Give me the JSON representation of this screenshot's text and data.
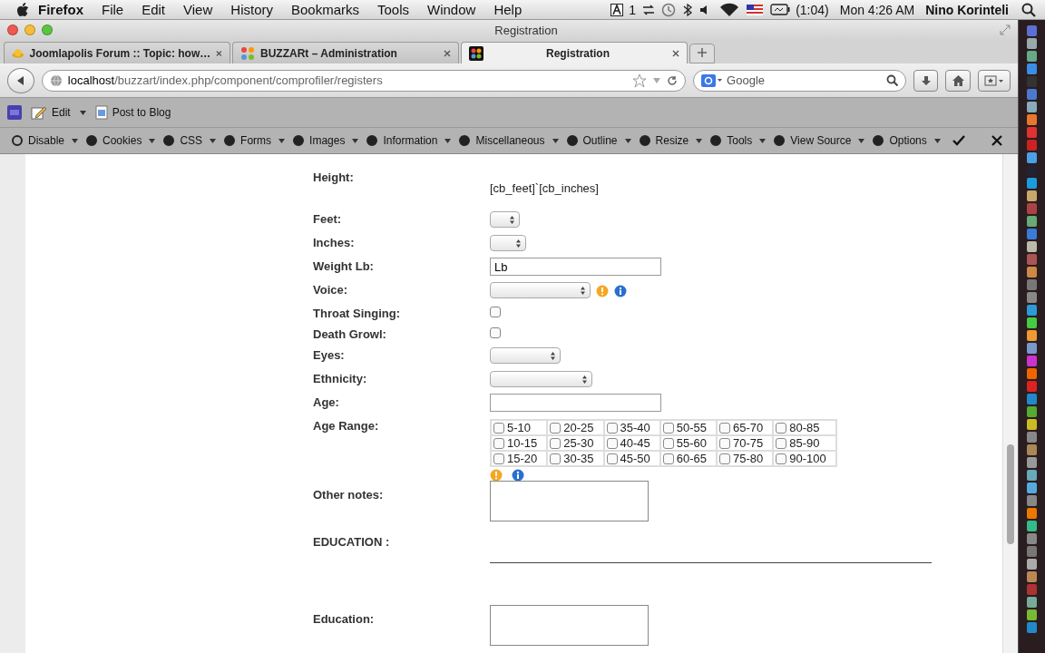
{
  "menubar": {
    "app": "Firefox",
    "items": [
      "File",
      "Edit",
      "View",
      "History",
      "Bookmarks",
      "Tools",
      "Window",
      "Help"
    ],
    "input_indicator": "1",
    "battery": "(1:04)",
    "clock": "Mon 4:26 AM",
    "user": "Nino Korinteli"
  },
  "window": {
    "title": "Registration"
  },
  "tabs": [
    {
      "label": "Joomlapolis Forum :: Topic: how…",
      "selected": false
    },
    {
      "label": "BUZZARt – Administration",
      "selected": false
    },
    {
      "label": "Registration",
      "selected": true
    }
  ],
  "address": {
    "host": "localhost",
    "path": "/buzzart/index.php/component/comprofiler/registers"
  },
  "search": {
    "placeholder": "Google"
  },
  "bookmarks": [
    "Edit",
    "Post to Blog"
  ],
  "dev_toolbar": [
    "Disable",
    "Cookies",
    "CSS",
    "Forms",
    "Images",
    "Information",
    "Miscellaneous",
    "Outline",
    "Resize",
    "Tools",
    "View Source",
    "Options"
  ],
  "form": [
    {
      "kind": "static",
      "label": "Height:",
      "value": "[cb_feet]`[cb_inches]"
    },
    {
      "kind": "select",
      "label": "Feet:"
    },
    {
      "kind": "select",
      "label": "Inches:"
    },
    {
      "kind": "input",
      "label": "Weight Lb:",
      "value": "Lb"
    },
    {
      "kind": "select",
      "label": "Voice:",
      "help_icons": true
    },
    {
      "kind": "checkbox",
      "label": "Throat Singing:",
      "checked": false
    },
    {
      "kind": "checkbox",
      "label": "Death Growl:",
      "checked": false
    },
    {
      "kind": "select",
      "label": "Eyes:"
    },
    {
      "kind": "select",
      "label": "Ethnicity:"
    },
    {
      "kind": "input",
      "label": "Age:"
    },
    {
      "kind": "checkgroup",
      "label": "Age Range:",
      "help_icons": true,
      "rows": [
        [
          {
            "label": "5-10",
            "checked": false
          },
          {
            "label": "20-25",
            "checked": false
          },
          {
            "label": "35-40",
            "checked": false
          },
          {
            "label": "50-55",
            "checked": false
          },
          {
            "label": "65-70",
            "checked": false
          },
          {
            "label": "80-85",
            "checked": false
          }
        ],
        [
          {
            "label": "10-15",
            "checked": false
          },
          {
            "label": "25-30",
            "checked": false
          },
          {
            "label": "40-45",
            "checked": false
          },
          {
            "label": "55-60",
            "checked": false
          },
          {
            "label": "70-75",
            "checked": false
          },
          {
            "label": "85-90",
            "checked": false
          }
        ],
        [
          {
            "label": "15-20",
            "checked": false
          },
          {
            "label": "30-35",
            "checked": false
          },
          {
            "label": "45-50",
            "checked": false
          },
          {
            "label": "60-65",
            "checked": false
          },
          {
            "label": "75-80",
            "checked": false
          },
          {
            "label": "90-100",
            "checked": false
          }
        ]
      ]
    },
    {
      "kind": "textarea",
      "label": "Other notes:"
    },
    {
      "kind": "section",
      "label": "EDUCATION :"
    },
    {
      "kind": "textarea",
      "label": "Education:"
    }
  ]
}
